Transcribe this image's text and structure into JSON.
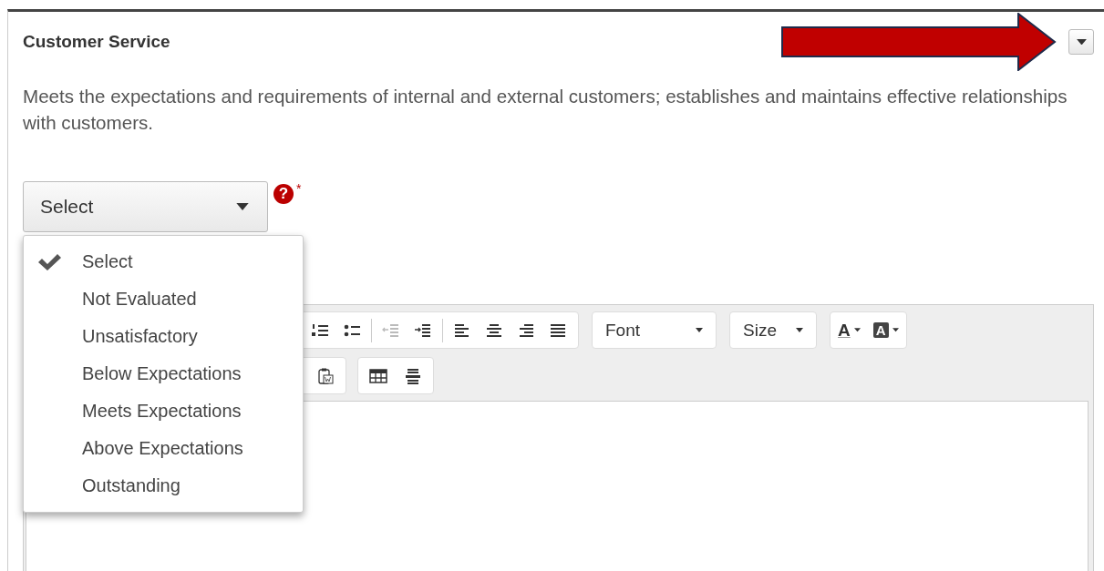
{
  "section": {
    "title": "Customer Service",
    "description": "Meets the expectations and requirements of internal and external customers; establishes and maintains effective relationships with customers."
  },
  "rating_select": {
    "value": "Select",
    "help": "?",
    "required_mark": "*",
    "expanded": true
  },
  "rating_options": [
    {
      "label": "Select",
      "selected": true
    },
    {
      "label": "Not Evaluated",
      "selected": false
    },
    {
      "label": "Unsatisfactory",
      "selected": false
    },
    {
      "label": "Below Expectations",
      "selected": false
    },
    {
      "label": "Meets Expectations",
      "selected": false
    },
    {
      "label": "Above Expectations",
      "selected": false
    },
    {
      "label": "Outstanding",
      "selected": false
    }
  ],
  "editor": {
    "dropdowns": [
      {
        "label": "Font"
      },
      {
        "label": "Size"
      }
    ],
    "color_buttons": [
      {
        "kind": "text-color",
        "glyph": "A"
      },
      {
        "kind": "background-color",
        "glyph": "A"
      }
    ]
  }
}
